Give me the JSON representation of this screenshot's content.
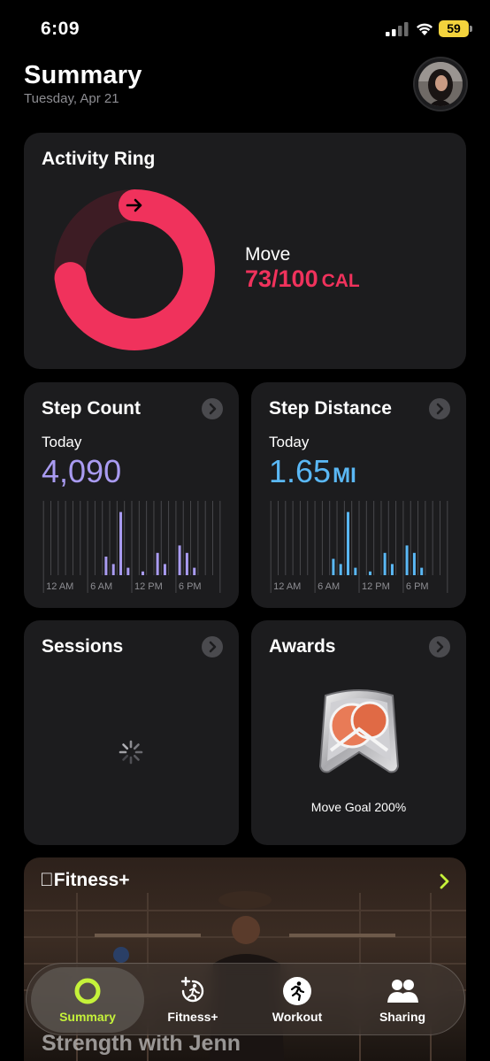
{
  "status_bar": {
    "time": "6:09",
    "battery": "59"
  },
  "header": {
    "title": "Summary",
    "date": "Tuesday, Apr 21"
  },
  "activity": {
    "title": "Activity Ring",
    "move_label": "Move",
    "move_value": "73/100",
    "move_unit": "CAL",
    "move_progress": 0.73,
    "ring_color": "#f0325c",
    "ring_track_color": "#3d1c24"
  },
  "steps": {
    "title": "Step Count",
    "today_label": "Today",
    "value": "4,090",
    "accent": "#a99bf1",
    "axis_labels": [
      "12 AM",
      "6 AM",
      "12 PM",
      "6 PM"
    ],
    "bars": [
      0,
      0,
      0,
      0,
      0,
      0,
      0,
      0,
      0.25,
      0.15,
      0.85,
      0.1,
      0,
      0.05,
      0,
      0.3,
      0.15,
      0,
      0.4,
      0.3,
      0.1,
      0,
      0,
      0
    ]
  },
  "distance": {
    "title": "Step Distance",
    "today_label": "Today",
    "value": "1.65",
    "unit": "MI",
    "accent": "#5ab8f5",
    "axis_labels": [
      "12 AM",
      "6 AM",
      "12 PM",
      "6 PM"
    ],
    "bars": [
      0,
      0,
      0,
      0,
      0,
      0,
      0,
      0,
      0.22,
      0.15,
      0.85,
      0.1,
      0,
      0.05,
      0,
      0.3,
      0.15,
      0,
      0.4,
      0.3,
      0.1,
      0,
      0,
      0
    ]
  },
  "sessions": {
    "title": "Sessions"
  },
  "awards": {
    "title": "Awards",
    "award_label": "Move Goal 200%"
  },
  "fitness_plus": {
    "logo": "Fitness+",
    "caption": "Strength with Jenn"
  },
  "tab_bar": {
    "tabs": [
      {
        "label": "Summary",
        "icon": "activity-ring-icon",
        "active": true
      },
      {
        "label": "Fitness+",
        "icon": "fitness-plus-icon",
        "active": false
      },
      {
        "label": "Workout",
        "icon": "workout-runner-icon",
        "active": false
      },
      {
        "label": "Sharing",
        "icon": "sharing-people-icon",
        "active": false
      }
    ]
  }
}
